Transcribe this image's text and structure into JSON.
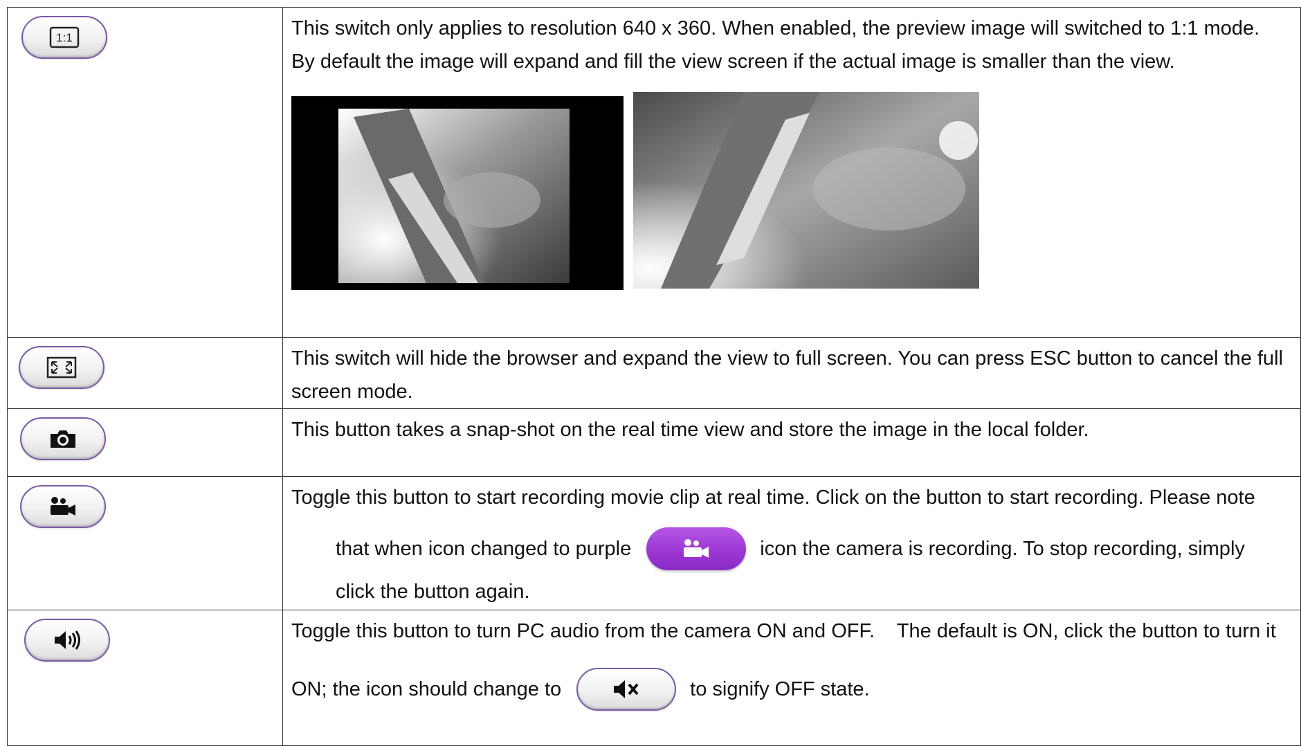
{
  "rows": [
    {
      "button_icon": "one-to-one-icon",
      "button_label": "1:1",
      "lines": [
        "This switch only applies to resolution 640 x 360. When enabled, the preview image will switched to 1:1 mode.",
        "By default the image will expand and fill the view screen if the actual image is smaller than the view."
      ],
      "images": [
        "preview-1to1-image",
        "preview-expanded-image"
      ]
    },
    {
      "button_icon": "fullscreen-icon",
      "lines": [
        "This switch will hide the browser and expand the view to full screen. You can press ESC button to cancel the full",
        "screen mode."
      ]
    },
    {
      "button_icon": "camera-icon",
      "lines": [
        "This button takes a snap-shot on the real time view and store the image in the local folder."
      ]
    },
    {
      "button_icon": "video-camera-icon",
      "line1": "Toggle this button to start recording movie clip at real time. Click on the button to start recording. Please note",
      "line2_before": "that when icon changed to purple",
      "line2_after": "icon the camera is recording. To stop recording, simply",
      "line3": "click the button again.",
      "inline_button_icon": "video-camera-icon",
      "inline_button_color": "#9b35d2"
    },
    {
      "button_icon": "speaker-on-icon",
      "line1": "Toggle this button to turn PC audio from the camera ON and OFF.    The default is ON, click the button to turn it",
      "line2_before": "ON; the icon should change to",
      "line2_after": "to signify OFF state.",
      "inline_button_icon": "speaker-mute-icon"
    }
  ],
  "colors": {
    "border": "#333333",
    "pill_border": "#7a5aa8",
    "recording_purple": "#9b35d2"
  }
}
